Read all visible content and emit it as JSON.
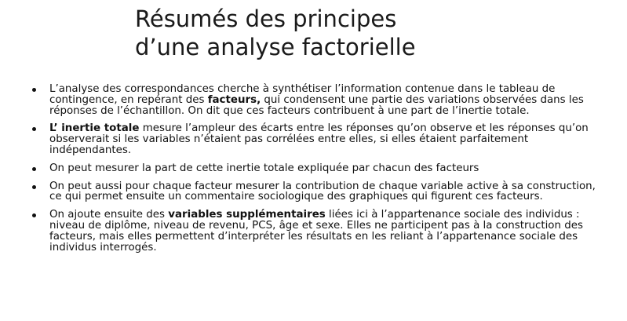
{
  "slide": {
    "title_line1": "Résumés des principes",
    "title_line2": "d’une analyse factorielle",
    "bullets": [
      {
        "pre": "L’analyse des correspondances cherche à synthétiser l’information contenue dans le tableau de contingence, en repérant des ",
        "bold": "facteurs,",
        "post": " qui condensent une partie des variations observées dans les réponses de l’échantillon. On dit que ces facteurs contribuent à une part de l’inertie totale."
      },
      {
        "pre": "",
        "bold": "L’ inertie totale",
        "post": " mesure l’ampleur des écarts entre les réponses qu’on observe et les réponses qu’on observerait si les variables n’étaient pas corrélées entre elles, si elles étaient parfaitement indépendantes."
      },
      {
        "pre": "On peut mesurer la part de cette inertie totale expliquée par chacun des facteurs",
        "bold": "",
        "post": ""
      },
      {
        "pre": "On peut aussi pour chaque facteur mesurer la contribution de chaque variable active à sa construction, ce qui permet ensuite un commentaire sociologique des graphiques qui figurent ces facteurs.",
        "bold": "",
        "post": ""
      },
      {
        "pre": "On ajoute ensuite des ",
        "bold": "variables supplémentaires",
        "post": " liées ici à l’appartenance sociale des individus : niveau de diplôme, niveau de revenu, PCS, âge et sexe. Elles ne participent pas à la construction des facteurs, mais elles permettent d’interpréter les résultats en les reliant à l’appartenance sociale des individus interrogés."
      }
    ]
  }
}
